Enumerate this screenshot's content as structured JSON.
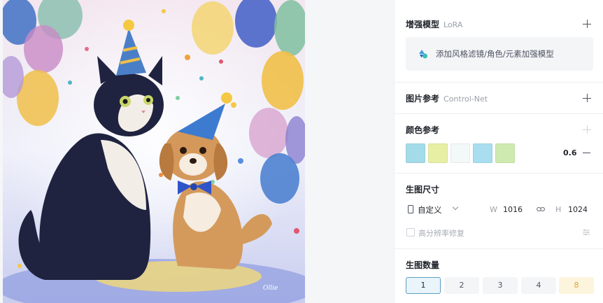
{
  "artwork": {
    "signature": "Ollie"
  },
  "lora": {
    "title": "增强模型",
    "subtitle": "LoRA",
    "placeholder": "添加风格滤镜/角色/元素加强模型"
  },
  "controlnet": {
    "title": "图片参考",
    "subtitle": "Control-Net"
  },
  "color_ref": {
    "title": "颜色参考",
    "swatches": [
      "#a4dbe8",
      "#e6efa4",
      "#f3f8f9",
      "#a8def0",
      "#cfeab0"
    ],
    "strength": "0.6"
  },
  "size": {
    "title": "生图尺寸",
    "mode": "自定义",
    "w_label": "W",
    "w_value": "1016",
    "h_label": "H",
    "h_value": "1024",
    "hires_label": "高分辨率修复"
  },
  "count": {
    "title": "生图数量",
    "options": [
      "1",
      "2",
      "3",
      "4",
      "8"
    ],
    "selected": "1"
  }
}
